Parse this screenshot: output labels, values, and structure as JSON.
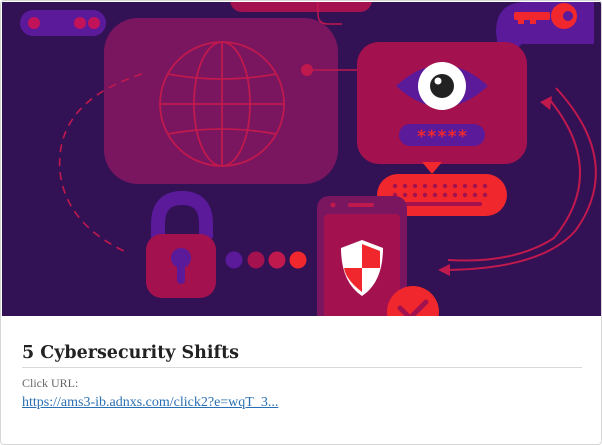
{
  "hero": {
    "alt": "cybersecurity illustration",
    "password_mask": "*****",
    "colors": {
      "background": "#321155",
      "panel": "#7a1560",
      "magenta": "#a3124e",
      "red": "#f0282d",
      "purple": "#5a1a9a",
      "white": "#ffffff"
    }
  },
  "card": {
    "title": "5 Cybersecurity Shifts",
    "click_label": "Click URL:",
    "click_url": "https://ams3-ib.adnxs.com/click2?e=wqT_3..."
  }
}
